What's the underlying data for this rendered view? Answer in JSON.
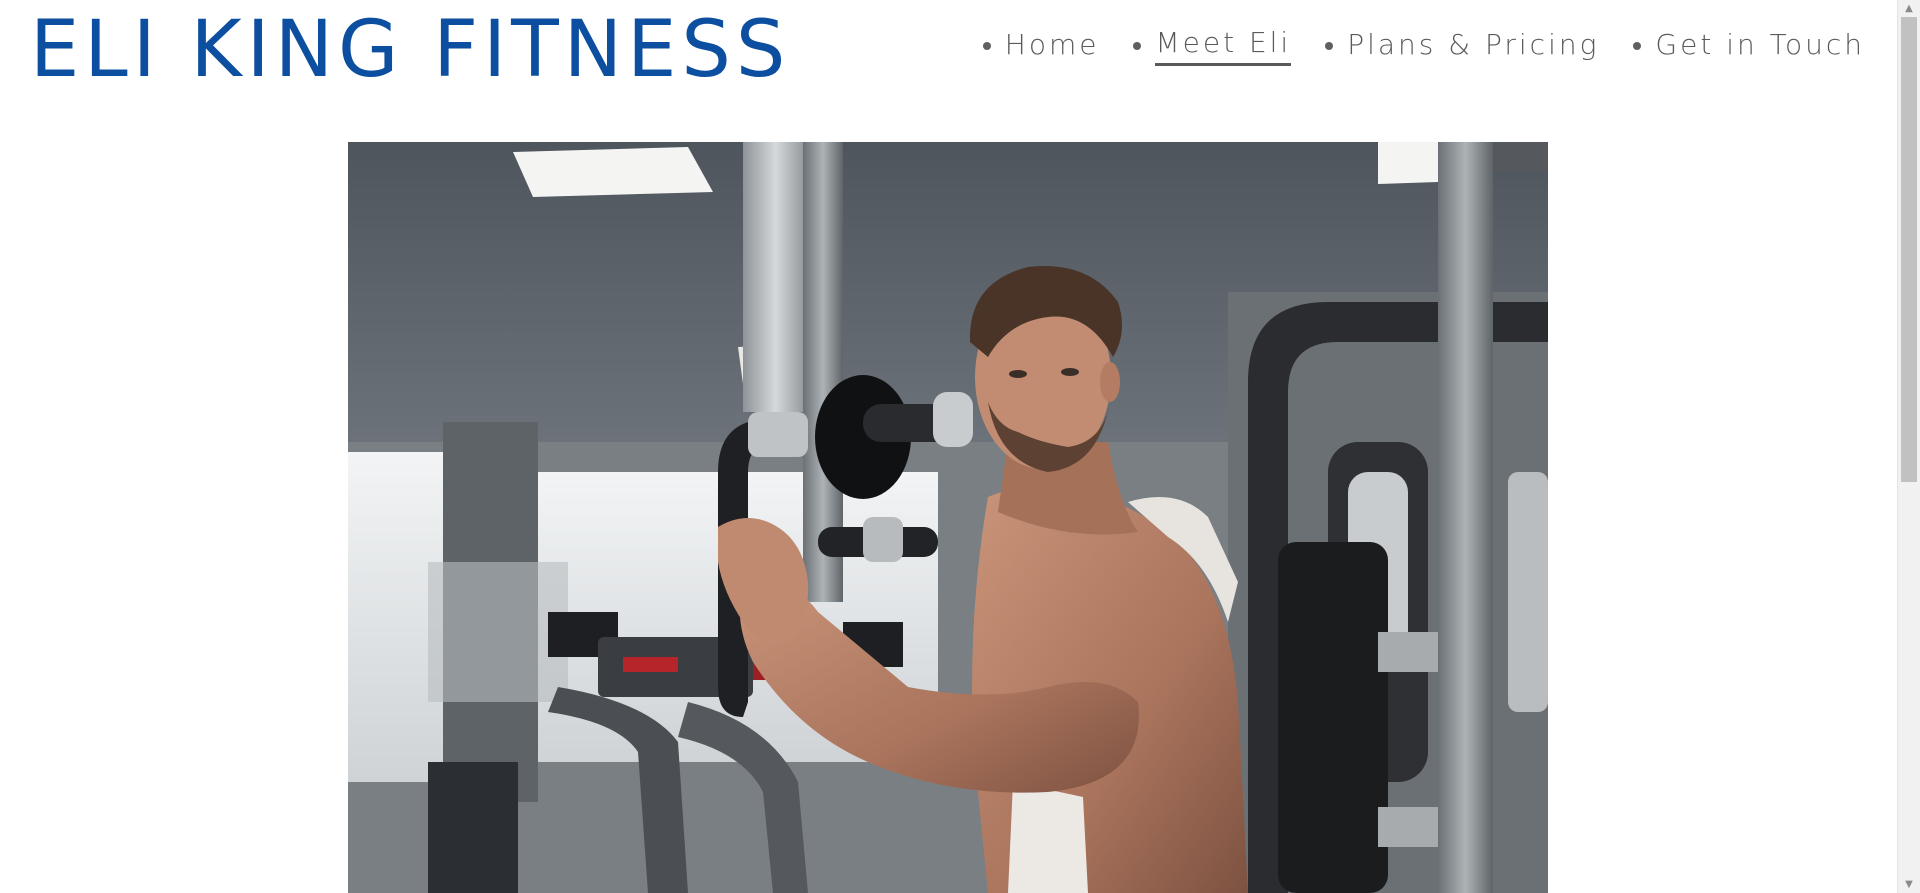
{
  "site": {
    "brand": "ELI KING FITNESS",
    "brand_color": "#0c4ea0"
  },
  "nav": {
    "items": [
      {
        "label": "Home",
        "active": false
      },
      {
        "label": "Meet Eli",
        "active": true
      },
      {
        "label": "Plans & Pricing",
        "active": false
      },
      {
        "label": "Get in Touch",
        "active": false
      }
    ]
  },
  "hero": {
    "image_icon": "gym-photo"
  },
  "scrollbar": {
    "up_icon": "scroll-up-arrow-icon",
    "down_icon": "scroll-down-arrow-icon",
    "up_glyph": "▲",
    "down_glyph": "▼"
  }
}
